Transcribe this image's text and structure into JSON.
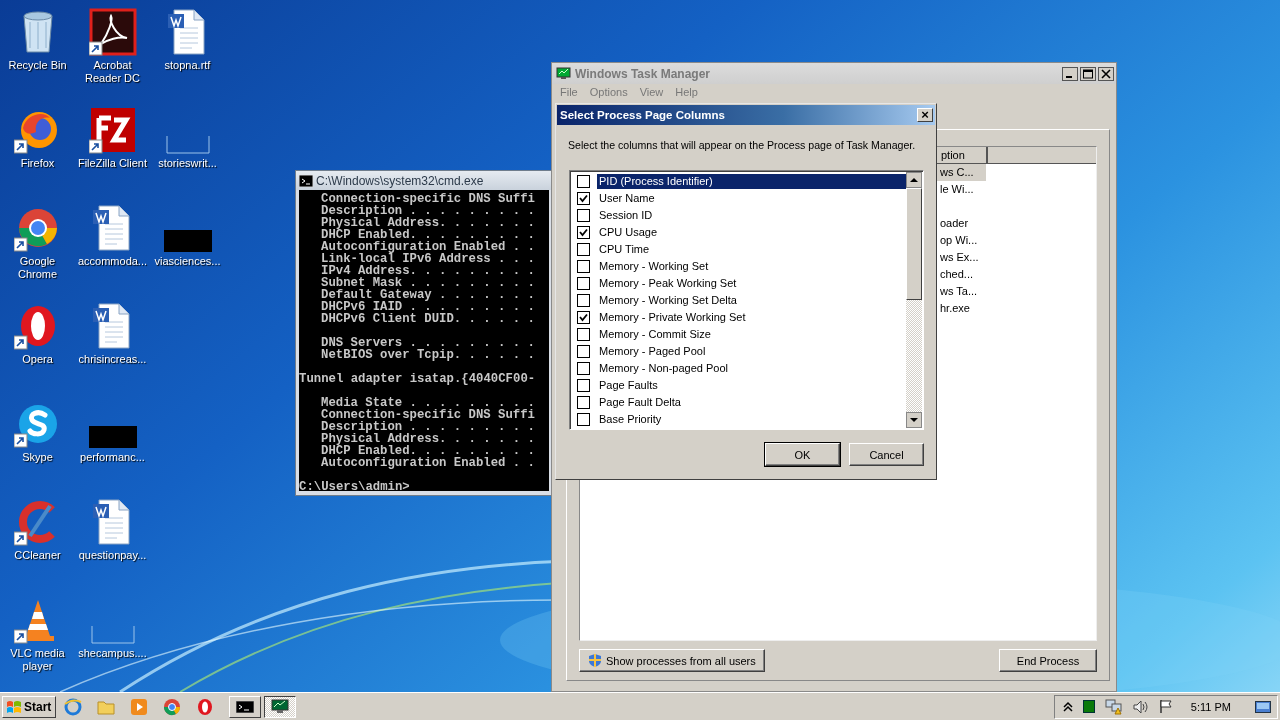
{
  "desktop_icons": [
    {
      "label": "Recycle Bin",
      "kind": "recycle",
      "shortcut": false
    },
    {
      "label": "Firefox",
      "kind": "firefox",
      "shortcut": true
    },
    {
      "label": "Google Chrome",
      "kind": "chrome",
      "shortcut": true
    },
    {
      "label": "Opera",
      "kind": "opera",
      "shortcut": true
    },
    {
      "label": "Skype",
      "kind": "skype",
      "shortcut": true
    },
    {
      "label": "CCleaner",
      "kind": "ccleaner",
      "shortcut": true
    },
    {
      "label": "VLC media player",
      "kind": "vlc",
      "shortcut": true
    },
    {
      "label": "Acrobat Reader DC",
      "kind": "acrobat",
      "shortcut": true
    },
    {
      "label": "FileZilla Client",
      "kind": "filezilla",
      "shortcut": true
    },
    {
      "label": "accommoda...",
      "kind": "word",
      "shortcut": false
    },
    {
      "label": "chrisincreas...",
      "kind": "word",
      "shortcut": false
    },
    {
      "label": "performanc...",
      "kind": "redacted",
      "shortcut": false
    },
    {
      "label": "questionpay...",
      "kind": "word",
      "shortcut": false
    },
    {
      "label": "shecampus....",
      "kind": "blank",
      "shortcut": false
    },
    {
      "label": "stopna.rtf",
      "kind": "word",
      "shortcut": false
    },
    {
      "label": "storieswrit...",
      "kind": "blank",
      "shortcut": false
    },
    {
      "label": "viasciences...",
      "kind": "redacted",
      "shortcut": false
    }
  ],
  "console": {
    "title": "C:\\Windows\\system32\\cmd.exe",
    "blocks": [
      {
        "indent": true,
        "lines": [
          "Connection-specific DNS Suffi",
          "Description . . . . . . . . .",
          "Physical Address. . . . . . .",
          "DHCP Enabled. . . . . . . . .",
          "Autoconfiguration Enabled . .",
          "Link-local IPv6 Address . . .",
          "IPv4 Address. . . . . . . . .",
          "Subnet Mask . . . . . . . . .",
          "Default Gateway . . . . . . .",
          "DHCPv6 IAID . . . . . . . . .",
          "DHCPv6 Client DUID. . . . . ."
        ]
      },
      {
        "indent": true,
        "lines": [
          "DNS Servers . . . . . . . . .",
          "NetBIOS over Tcpip. . . . . ."
        ]
      },
      {
        "indent": false,
        "lines": [
          "Tunnel adapter isatap.{4040CF00-"
        ]
      },
      {
        "indent": true,
        "lines": [
          "Media State . . . . . . . . .",
          "Connection-specific DNS Suffi",
          "Description . . . . . . . . .",
          "Physical Address. . . . . . .",
          "DHCP Enabled. . . . . . . . .",
          "Autoconfiguration Enabled . ."
        ]
      },
      {
        "indent": false,
        "lines": [
          "C:\\Users\\admin>"
        ]
      }
    ]
  },
  "task_manager": {
    "title": "Windows Task Manager",
    "menu": [
      "File",
      "Options",
      "View",
      "Help"
    ],
    "column_header": "ption",
    "rows": [
      {
        "text": "ws C...",
        "selected": true,
        "spaced": false
      },
      {
        "text": "le Wi...",
        "selected": false,
        "spaced": false
      },
      {
        "text": "oader",
        "selected": false,
        "spaced": true
      },
      {
        "text": "op Wi...",
        "selected": false,
        "spaced": false
      },
      {
        "text": "ws Ex...",
        "selected": false,
        "spaced": false
      },
      {
        "text": "ched...",
        "selected": false,
        "spaced": false
      },
      {
        "text": "ws Ta...",
        "selected": false,
        "spaced": false
      },
      {
        "text": "hr.exe",
        "selected": false,
        "spaced": false
      }
    ],
    "show_all_button": "Show processes from all users",
    "end_button": "End Process"
  },
  "dialog": {
    "title": "Select Process Page Columns",
    "close": "×",
    "description": "Select the columns that will appear on the Process page of Task Manager.",
    "items": [
      {
        "label": "PID (Process Identifier)",
        "checked": false,
        "selected": true
      },
      {
        "label": "User Name",
        "checked": true,
        "selected": false
      },
      {
        "label": "Session ID",
        "checked": false,
        "selected": false
      },
      {
        "label": "CPU Usage",
        "checked": true,
        "selected": false
      },
      {
        "label": "CPU Time",
        "checked": false,
        "selected": false
      },
      {
        "label": "Memory - Working Set",
        "checked": false,
        "selected": false
      },
      {
        "label": "Memory - Peak Working Set",
        "checked": false,
        "selected": false
      },
      {
        "label": "Memory - Working Set Delta",
        "checked": false,
        "selected": false
      },
      {
        "label": "Memory - Private Working Set",
        "checked": true,
        "selected": false
      },
      {
        "label": "Memory - Commit Size",
        "checked": false,
        "selected": false
      },
      {
        "label": "Memory - Paged Pool",
        "checked": false,
        "selected": false
      },
      {
        "label": "Memory - Non-paged Pool",
        "checked": false,
        "selected": false
      },
      {
        "label": "Page Faults",
        "checked": false,
        "selected": false
      },
      {
        "label": "Page Fault Delta",
        "checked": false,
        "selected": false
      },
      {
        "label": "Base Priority",
        "checked": false,
        "selected": false
      }
    ],
    "buttons": [
      "OK",
      "Cancel"
    ]
  },
  "taskbar": {
    "start": "Start",
    "quick_launch": [
      {
        "kind": "ie"
      },
      {
        "kind": "folder"
      },
      {
        "kind": "media"
      },
      {
        "kind": "chrome"
      },
      {
        "kind": "opera"
      }
    ],
    "tasks": [
      {
        "kind": "console",
        "selected": false
      },
      {
        "kind": "taskmgr",
        "selected": true
      }
    ],
    "clock": "5:11 PM"
  }
}
